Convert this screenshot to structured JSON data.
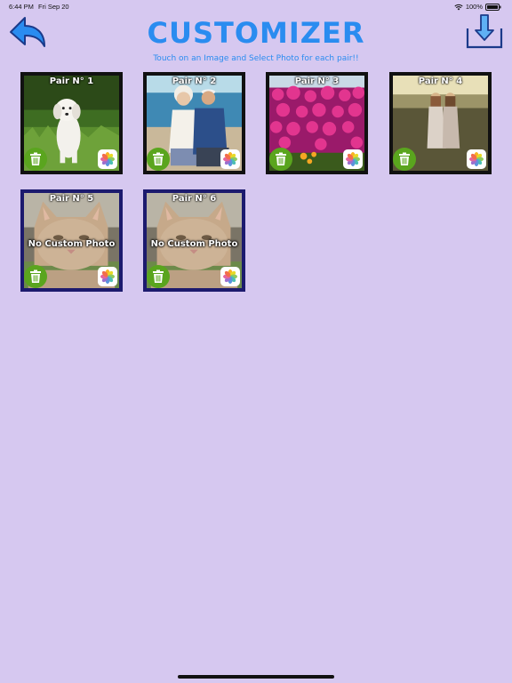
{
  "status_bar": {
    "time": "6:44 PM",
    "date": "Fri Sep 20",
    "battery": "100%"
  },
  "header": {
    "title": "CUSTOMIZER",
    "subtitle": "Touch on an Image and Select Photo for each pair!!",
    "back_icon": "back-arrow-icon",
    "download_icon": "download-tray-icon"
  },
  "pairs": [
    {
      "label": "Pair N° 1",
      "photo": "white-puppy-on-grass"
    },
    {
      "label": "Pair N° 2",
      "photo": "elderly-couple-by-sea"
    },
    {
      "label": "Pair N° 3",
      "photo": "pink-flowers"
    },
    {
      "label": "Pair N° 4",
      "photo": "two-girls-in-field"
    },
    {
      "label": "Pair N° 5",
      "photo": "cat-placeholder",
      "overlay": "No Custom Photo"
    },
    {
      "label": "Pair N° 6",
      "photo": "cat-placeholder",
      "overlay": "No Custom Photo"
    }
  ],
  "colors": {
    "background": "#d6c8f0",
    "accent": "#2a8cf0",
    "trash_green": "#5aa51e"
  }
}
